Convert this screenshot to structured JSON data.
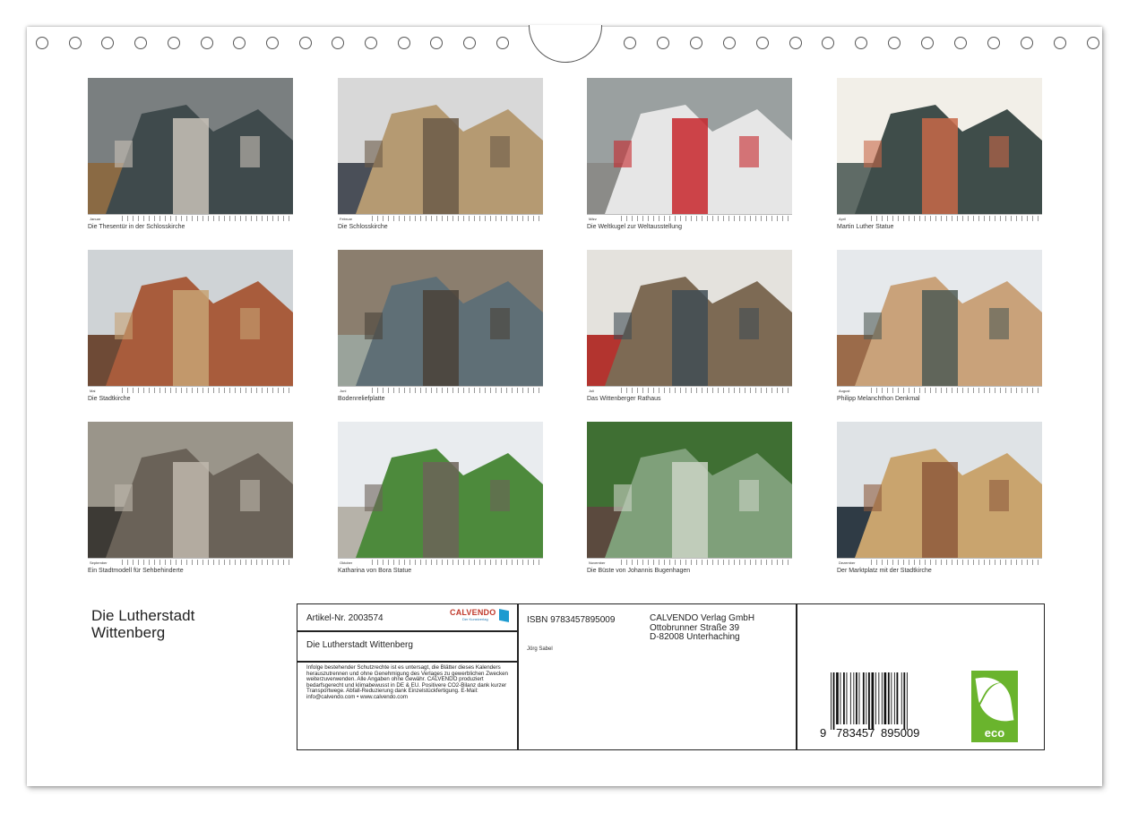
{
  "calendar": {
    "title_line1": "Die Lutherstadt",
    "title_line2": "Wittenberg"
  },
  "months": [
    {
      "month": "Januar",
      "caption": "Die Thesentür in der Schlosskirche",
      "icon": "door-photo"
    },
    {
      "month": "Februar",
      "caption": "Die Schlosskirche",
      "icon": "church-street-photo"
    },
    {
      "month": "März",
      "caption": "Die Weltkugel zur Weltausstellung",
      "icon": "globe-sculpture-photo"
    },
    {
      "month": "April",
      "caption": "Martin Luther Statue",
      "icon": "statue-photo"
    },
    {
      "month": "Mai",
      "caption": "Die Stadtkirche",
      "icon": "church-photo"
    },
    {
      "month": "Juni",
      "caption": "Bodenreliefplatte",
      "icon": "relief-plate-photo"
    },
    {
      "month": "Juli",
      "caption": "Das Wittenberger Rathaus",
      "icon": "townhall-photo"
    },
    {
      "month": "August",
      "caption": "Philipp Melanchthon Denkmal",
      "icon": "monument-photo"
    },
    {
      "month": "September",
      "caption": "Ein Stadtmodell für Sehbehinderte",
      "icon": "city-model-photo"
    },
    {
      "month": "Oktober",
      "caption": "Katharina von Bora Statue",
      "icon": "statue-garden-photo"
    },
    {
      "month": "November",
      "caption": "Die Büste von Johannis Bugenhagen",
      "icon": "bust-photo"
    },
    {
      "month": "Dezember",
      "caption": "Der Marktplatz mit der Stadtkirche",
      "icon": "market-square-photo"
    }
  ],
  "imprint": {
    "article": "Artikel-Nr. 2003574",
    "logo_word": "CALVENDO",
    "logo_sub": "Der Kunstverlag",
    "product_title": "Die Lutherstadt Wittenberg",
    "legal_text": "Infolge bestehender Schutzrechte ist es untersagt, die Blätter dieses Kalenders herauszutrennen und ohne Genehmigung des Verlages zu gewerblichen Zwecken weiterzuverwenden. Alle Angaben ohne Gewähr. CALVENDO produziert bedarfsgerecht und klimabewusst in DE & EU. Positivere CO2-Bilanz dank kurzer Transportwege. Abfall-Reduzierung dank Einzelstückfertigung. E-Mail: info@calvendo.com • www.calvendo.com",
    "isbn": "ISBN 9783457895009",
    "author": "Jörg Sabel",
    "publisher_line1": "CALVENDO Verlag GmbH",
    "publisher_line2": "Ottobrunner Straße 39",
    "publisher_line3": "D-82008 Unterhaching",
    "barcode_digit1": "9",
    "barcode_group1": "783457",
    "barcode_group2": "895009",
    "eco_label": "eco"
  },
  "colors": {
    "eco_green": "#6ab42d",
    "logo_red": "#c0392b",
    "logo_blue": "#1d9bd0"
  }
}
